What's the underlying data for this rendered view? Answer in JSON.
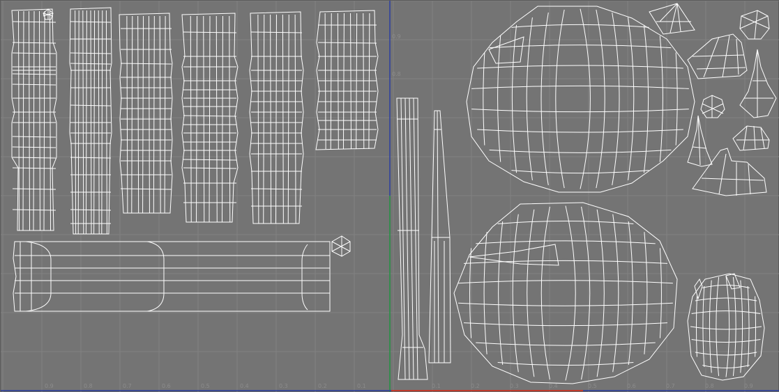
{
  "viewport": {
    "name": "uv-texture-editor",
    "colors": {
      "background": "#747474",
      "grid": "#828282",
      "uv_wire": "#ffffff",
      "u_axis": "#c0392b",
      "v_axis": "#2e9c3a",
      "frame": "#2b3ea0"
    }
  },
  "ticks": {
    "bottom_left": [
      "0.9",
      "0.8",
      "0.7",
      "0.6",
      "0.5",
      "0.4",
      "0.3",
      "0.2",
      "0.1"
    ],
    "bottom_right": [
      "0.1",
      "0.2",
      "0.3",
      "0.4",
      "0.5",
      "0.6",
      "0.7",
      "0.8",
      "0.9"
    ],
    "vertical": [
      "0.9",
      "0.8"
    ]
  }
}
